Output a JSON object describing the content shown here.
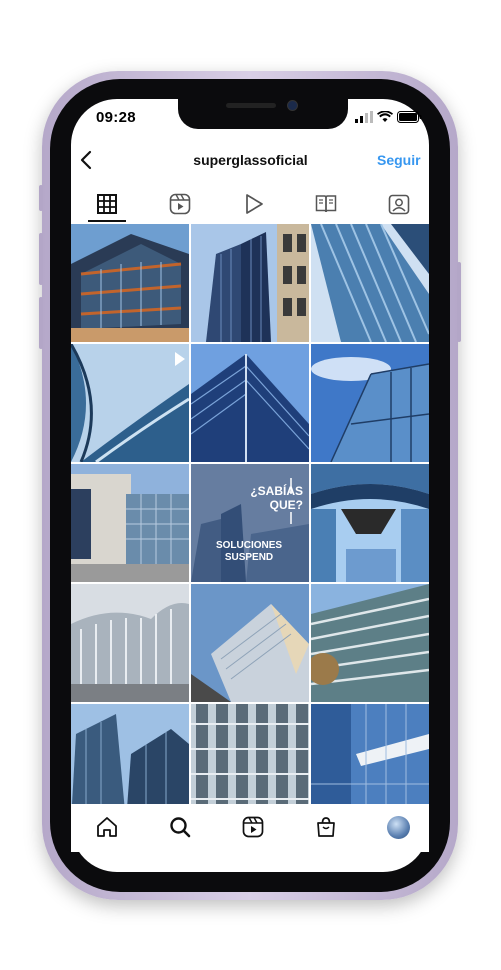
{
  "status_bar": {
    "time": "09:28"
  },
  "header": {
    "username": "superglassoficial",
    "follow_label": "Seguir"
  },
  "tabs": [
    {
      "name": "grid-tab",
      "icon": "grid-icon",
      "active": true
    },
    {
      "name": "reels-tab",
      "icon": "reels-icon"
    },
    {
      "name": "videos-tab",
      "icon": "play-icon"
    },
    {
      "name": "guides-tab",
      "icon": "guide-book-icon"
    },
    {
      "name": "tagged-tab",
      "icon": "tagged-person-icon"
    }
  ],
  "post_overlay": {
    "question": "¿SABÍAS QUE?",
    "title": "SOLUCIONES SUSPEND"
  },
  "bottom_nav": [
    "home-icon",
    "search-icon",
    "reels-icon",
    "shop-icon",
    "profile-avatar"
  ],
  "colors": {
    "accent": "#3797f0",
    "phone_frame": "#c7bbd9"
  }
}
